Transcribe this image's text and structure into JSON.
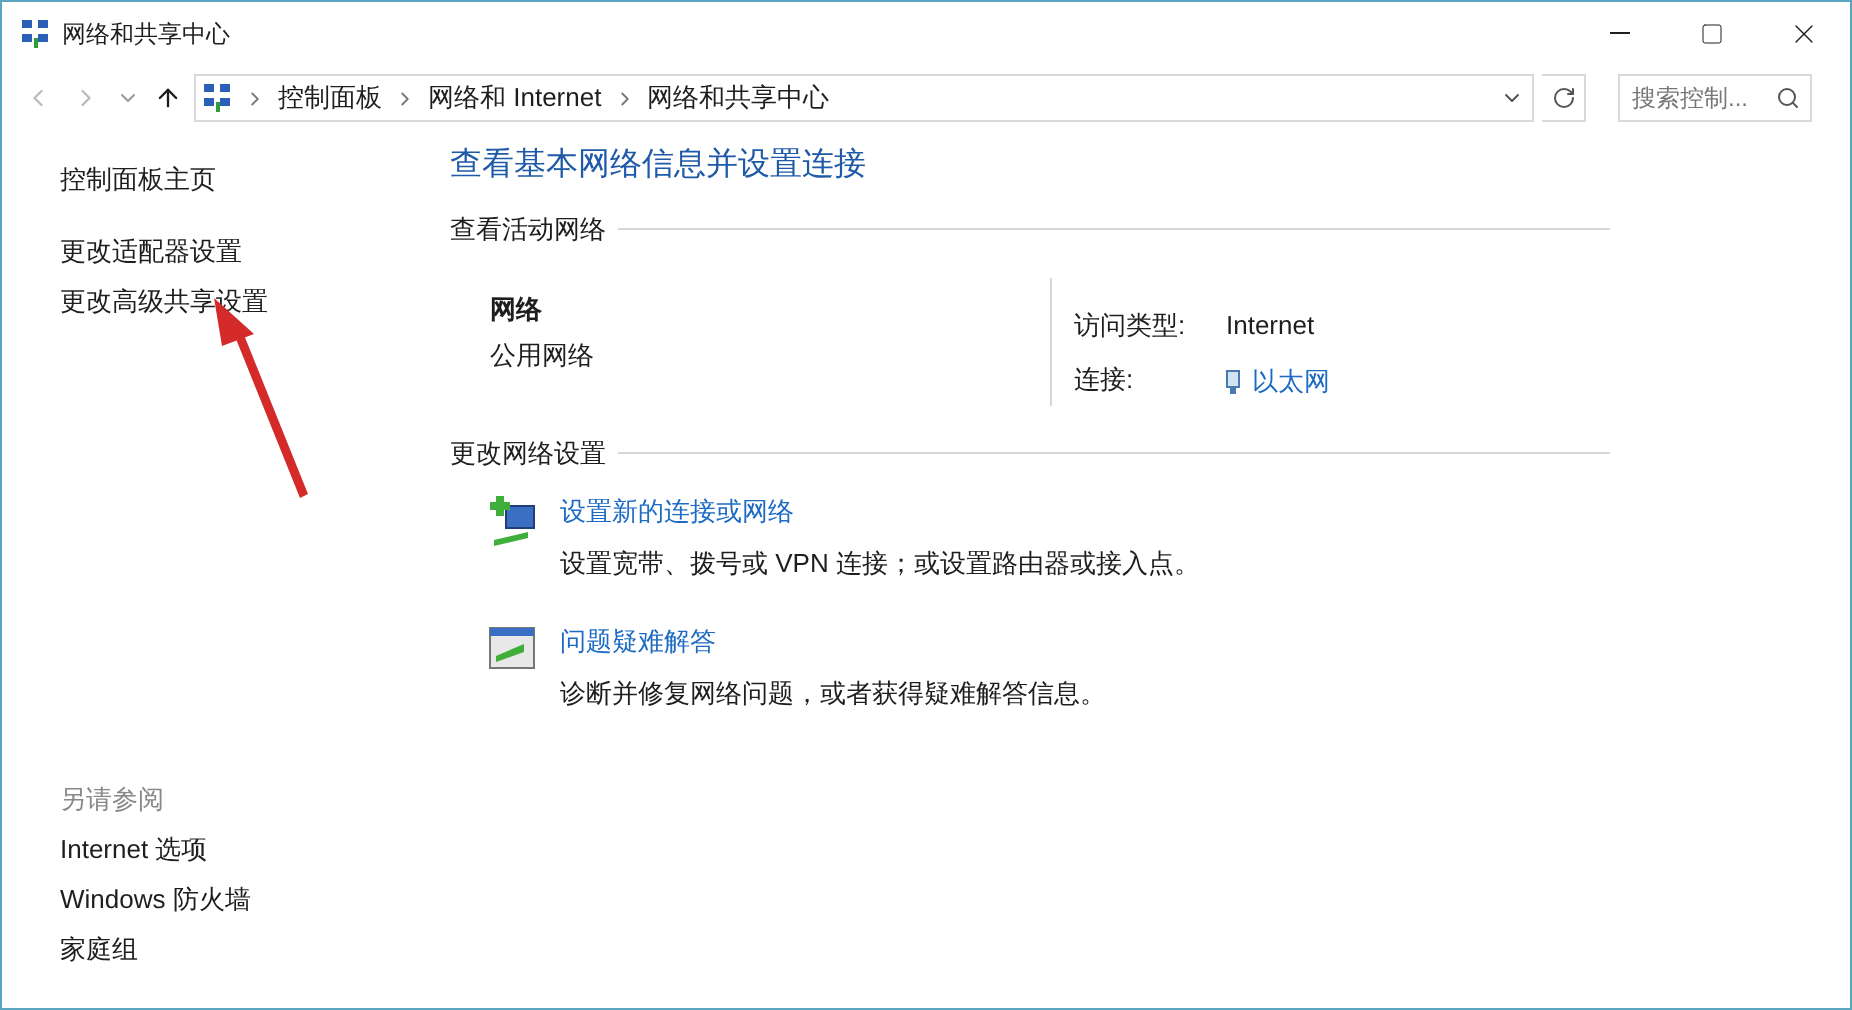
{
  "window": {
    "title": "网络和共享中心"
  },
  "address_bar": {
    "crumbs": [
      "控制面板",
      "网络和 Internet",
      "网络和共享中心"
    ]
  },
  "search": {
    "placeholder": "搜索控制..."
  },
  "sidebar": {
    "groups": [
      [
        "控制面板主页"
      ],
      [
        "更改适配器设置",
        "更改高级共享设置"
      ]
    ],
    "see_also": {
      "title": "另请参阅",
      "items": [
        "Internet 选项",
        "Windows 防火墙",
        "家庭组"
      ]
    }
  },
  "main": {
    "title": "查看基本网络信息并设置连接",
    "active_section": {
      "title": "查看活动网络",
      "network_name": "网络",
      "network_type": "公用网络",
      "access_label": "访问类型:",
      "access_value": "Internet",
      "connection_label": "连接:",
      "connection_value": "以太网"
    },
    "change_section": {
      "title": "更改网络设置",
      "tasks": [
        {
          "kind": "new-connection",
          "link": "设置新的连接或网络",
          "description": "设置宽带、拨号或 VPN 连接；或设置路由器或接入点。"
        },
        {
          "kind": "troubleshoot",
          "link": "问题疑难解答",
          "description": "诊断并修复网络问题，或者获得疑难解答信息。"
        }
      ]
    }
  }
}
